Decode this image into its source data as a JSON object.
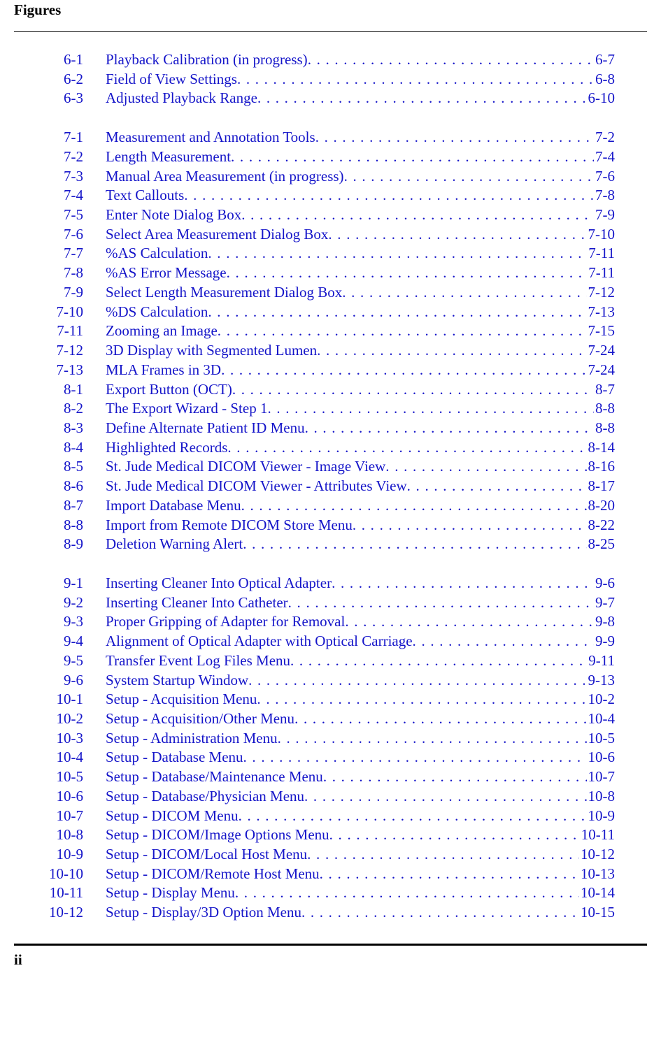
{
  "heading": "Figures",
  "footer_page": "ii",
  "groups": [
    [
      {
        "num": "6-1",
        "title": "Playback Calibration (in progress)",
        "page": "6-7"
      },
      {
        "num": "6-2",
        "title": "Field of View Settings",
        "page": "6-8"
      },
      {
        "num": "6-3",
        "title": "Adjusted Playback Range",
        "page": "6-10"
      }
    ],
    [
      {
        "num": "7-1",
        "title": "Measurement and Annotation Tools ",
        "page": "7-2"
      },
      {
        "num": "7-2",
        "title": "Length Measurement",
        "page": "7-4"
      },
      {
        "num": "7-3",
        "title": "Manual Area Measurement (in progress)",
        "page": "7-6"
      },
      {
        "num": "7-4",
        "title": "Text Callouts ",
        "page": "7-8"
      },
      {
        "num": "7-5",
        "title": "Enter Note Dialog Box",
        "page": "7-9"
      },
      {
        "num": "7-6",
        "title": "Select Area Measurement Dialog Box",
        "page": "7-10"
      },
      {
        "num": "7-7",
        "title": "%AS Calculation ",
        "page": "7-11"
      },
      {
        "num": "7-8",
        "title": "%AS Error Message",
        "page": "7-11"
      },
      {
        "num": "7-9",
        "title": "Select Length Measurement Dialog Box",
        "page": "7-12"
      },
      {
        "num": "7-10",
        "title": "%DS Calculation ",
        "page": "7-13"
      },
      {
        "num": "7-11",
        "title": "Zooming an Image",
        "page": "7-15"
      },
      {
        "num": "7-12",
        "title": "3D Display with Segmented Lumen ",
        "page": "7-24"
      },
      {
        "num": "7-13",
        "title": "MLA Frames in 3D ",
        "page": "7-24"
      },
      {
        "num": "8-1",
        "title": "Export Button (OCT)",
        "page": "8-7"
      },
      {
        "num": "8-2",
        "title": "The Export Wizard - Step 1",
        "page": "8-8"
      },
      {
        "num": "8-3",
        "title": "Define Alternate Patient ID Menu",
        "page": "8-8"
      },
      {
        "num": "8-4",
        "title": "Highlighted Records",
        "page": "8-14"
      },
      {
        "num": "8-5",
        "title": "St. Jude Medical DICOM Viewer - Image View",
        "page": "8-16"
      },
      {
        "num": "8-6",
        "title": "St. Jude Medical DICOM Viewer - Attributes View",
        "page": "8-17"
      },
      {
        "num": "8-7",
        "title": "Import Database Menu",
        "page": "8-20"
      },
      {
        "num": "8-8",
        "title": "Import from Remote DICOM Store Menu",
        "page": "8-22"
      },
      {
        "num": "8-9",
        "title": "Deletion Warning Alert",
        "page": "8-25"
      }
    ],
    [
      {
        "num": "9-1",
        "title": "Inserting Cleaner Into Optical Adapter ",
        "page": "9-6"
      },
      {
        "num": "9-2",
        "title": "Inserting Cleaner Into Catheter ",
        "page": "9-7"
      },
      {
        "num": "9-3",
        "title": "Proper Gripping of Adapter for Removal",
        "page": "9-8"
      },
      {
        "num": "9-4",
        "title": "Alignment of Optical Adapter with Optical Carriage ",
        "page": "9-9"
      },
      {
        "num": "9-5",
        "title": "Transfer Event Log Files Menu",
        "page": "9-11"
      },
      {
        "num": "9-6",
        "title": "System Startup Window",
        "page": "9-13"
      },
      {
        "num": "10-1",
        "title": "Setup - Acquisition Menu",
        "page": "10-2"
      },
      {
        "num": "10-2",
        "title": "Setup - Acquisition/Other Menu ",
        "page": "10-4"
      },
      {
        "num": "10-3",
        "title": "Setup - Administration Menu",
        "page": "10-5"
      },
      {
        "num": "10-4",
        "title": "Setup - Database Menu",
        "page": "10-6"
      },
      {
        "num": "10-5",
        "title": "Setup - Database/Maintenance Menu",
        "page": "10-7"
      },
      {
        "num": "10-6",
        "title": "Setup - Database/Physician Menu",
        "page": "10-8"
      },
      {
        "num": "10-7",
        "title": "Setup - DICOM Menu",
        "page": "10-9"
      },
      {
        "num": "10-8",
        "title": "Setup - DICOM/Image Options Menu",
        "page": "10-11"
      },
      {
        "num": "10-9",
        "title": "Setup - DICOM/Local Host Menu",
        "page": "10-12"
      },
      {
        "num": "10-10",
        "title": "Setup - DICOM/Remote Host Menu",
        "page": "10-13"
      },
      {
        "num": "10-11",
        "title": "Setup - Display Menu",
        "page": "10-14"
      },
      {
        "num": "10-12",
        "title": "Setup - Display/3D Option Menu",
        "page": "10-15"
      }
    ]
  ]
}
